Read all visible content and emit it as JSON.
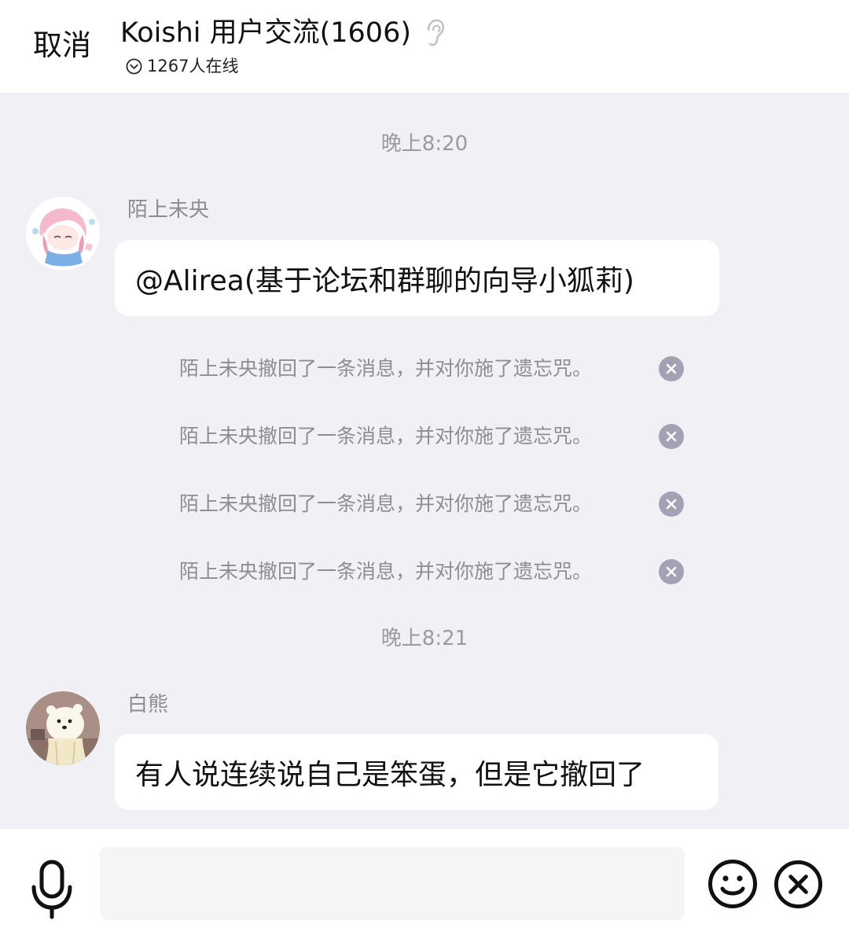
{
  "header": {
    "cancel_label": "取消",
    "title": "Koishi 用户交流(1606)",
    "online_text": "1267人在线"
  },
  "chat": {
    "time_1": "晚上8:20",
    "message_1": {
      "sender": "陌上未央",
      "text": "@Alirea(基于论坛和群聊的向导小狐莉)"
    },
    "system_messages": [
      "陌上未央撤回了一条消息，并对你施了遗忘咒。",
      "陌上未央撤回了一条消息，并对你施了遗忘咒。",
      "陌上未央撤回了一条消息，并对你施了遗忘咒。",
      "陌上未央撤回了一条消息，并对你施了遗忘咒。"
    ],
    "time_2": "晚上8:21",
    "message_2": {
      "sender": "白熊",
      "text": "有人说连续说自己是笨蛋，但是它撤回了"
    }
  },
  "input": {
    "placeholder": ""
  },
  "icons": {
    "ear": "ear-icon",
    "online": "chevron-circle-icon",
    "close_small": "close-circle-icon",
    "mic": "microphone-icon",
    "emoji": "emoji-icon",
    "close": "close-icon"
  },
  "colors": {
    "background": "#f1f0f4",
    "bubble": "#ffffff",
    "system_text": "#8e8d96",
    "close_badge": "#a2a2b4"
  }
}
